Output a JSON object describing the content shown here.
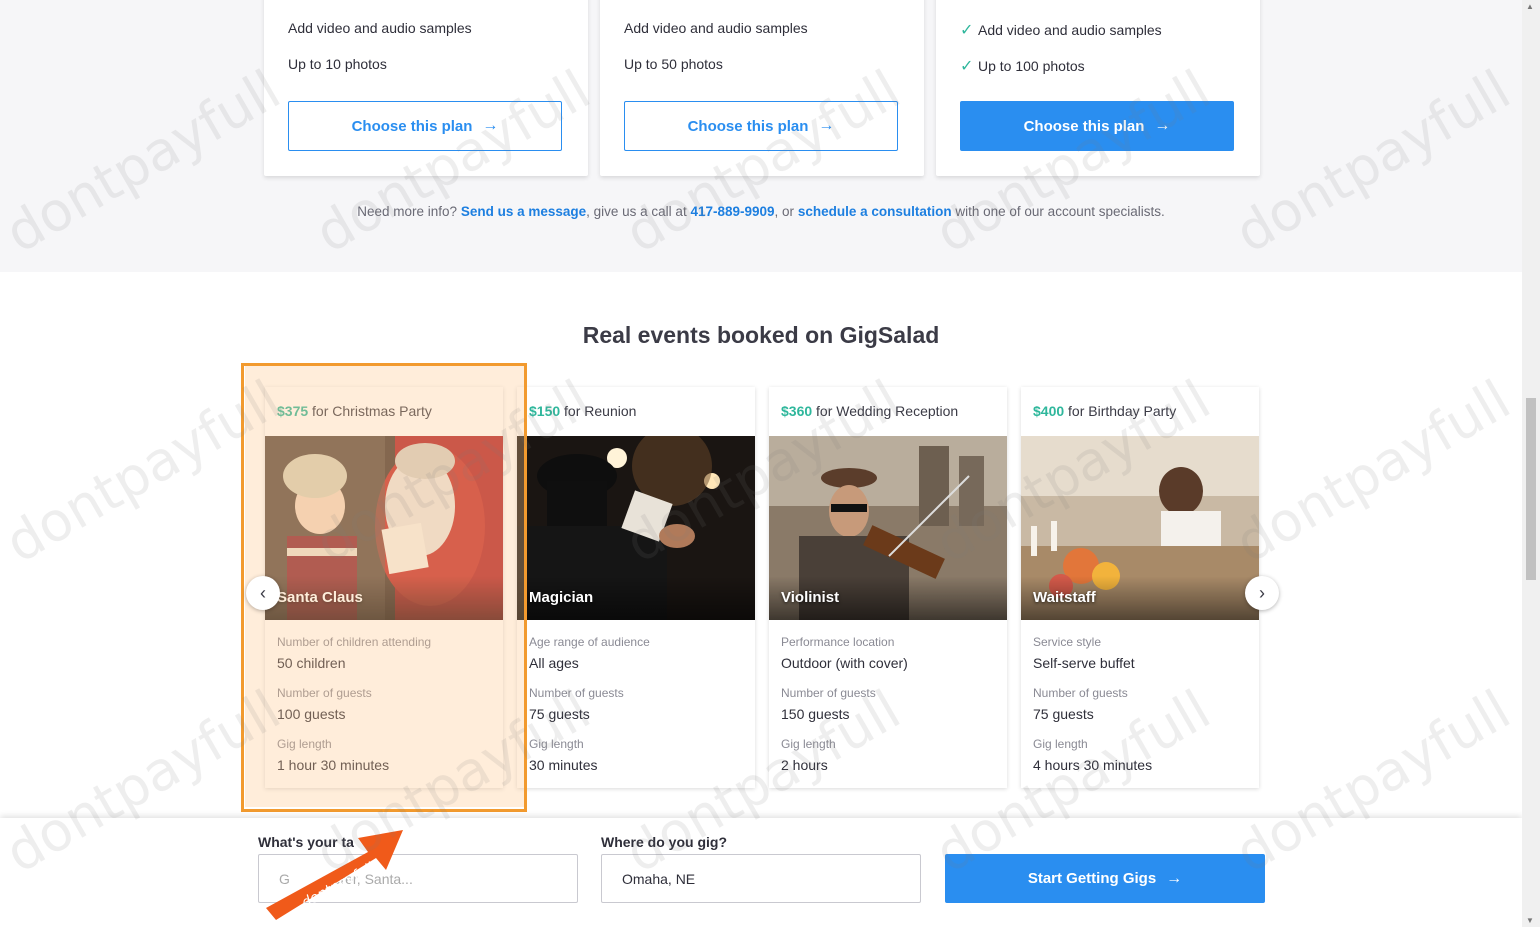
{
  "plans": [
    {
      "features": [
        "Add video and audio samples",
        "Up to 10 photos"
      ],
      "checks": false,
      "button": "Choose this plan",
      "primary": false
    },
    {
      "features": [
        "Add video and audio samples",
        "Up to 50 photos"
      ],
      "checks": false,
      "button": "Choose this plan",
      "primary": false
    },
    {
      "features": [
        "Add video and audio samples",
        "Up to 100 photos"
      ],
      "checks": true,
      "button": "Choose this plan",
      "primary": true
    }
  ],
  "info": {
    "prefix": "Need more info?",
    "send_message": "Send us a message",
    "mid1": ", give us a call at",
    "phone": "417-889-9909",
    "mid2": ", or",
    "schedule": "schedule a consultation",
    "suffix": "with one of our account specialists."
  },
  "events_title": "Real events booked on GigSalad",
  "events": [
    {
      "price": "$375",
      "occasion": "for Christmas Party",
      "talent": "Santa Claus",
      "details": [
        {
          "label": "Number of children attending",
          "value": "50 children"
        },
        {
          "label": "Number of guests",
          "value": "100 guests"
        },
        {
          "label": "Gig length",
          "value": "1 hour 30 minutes"
        }
      ]
    },
    {
      "price": "$150",
      "occasion": "for Reunion",
      "talent": "Magician",
      "details": [
        {
          "label": "Age range of audience",
          "value": "All ages"
        },
        {
          "label": "Number of guests",
          "value": "75 guests"
        },
        {
          "label": "Gig length",
          "value": "30 minutes"
        }
      ]
    },
    {
      "price": "$360",
      "occasion": "for Wedding Reception",
      "talent": "Violinist",
      "details": [
        {
          "label": "Performance location",
          "value": "Outdoor (with cover)"
        },
        {
          "label": "Number of guests",
          "value": "150 guests"
        },
        {
          "label": "Gig length",
          "value": "2 hours"
        }
      ]
    },
    {
      "price": "$400",
      "occasion": "for Birthday Party",
      "talent": "Waitstaff",
      "details": [
        {
          "label": "Service style",
          "value": "Self-serve buffet"
        },
        {
          "label": "Number of guests",
          "value": "75 guests"
        },
        {
          "label": "Gig length",
          "value": "4 hours 30 minutes"
        }
      ]
    }
  ],
  "carousel": {
    "prev_icon": "chevron-left-icon",
    "next_icon": "chevron-right-icon"
  },
  "signup": {
    "talent_label": "What's your ta",
    "talent_placeholder": "G        aterer, Santa...",
    "location_label": "Where do you gig?",
    "location_value": "Omaha, NE",
    "button": "Start Getting Gigs"
  },
  "promo_badge": "dontpayfull",
  "watermark": "dontpayfull",
  "colors": {
    "accent": "#2a8ef0",
    "price": "#2fb79c",
    "highlight": "#f29a2e"
  }
}
